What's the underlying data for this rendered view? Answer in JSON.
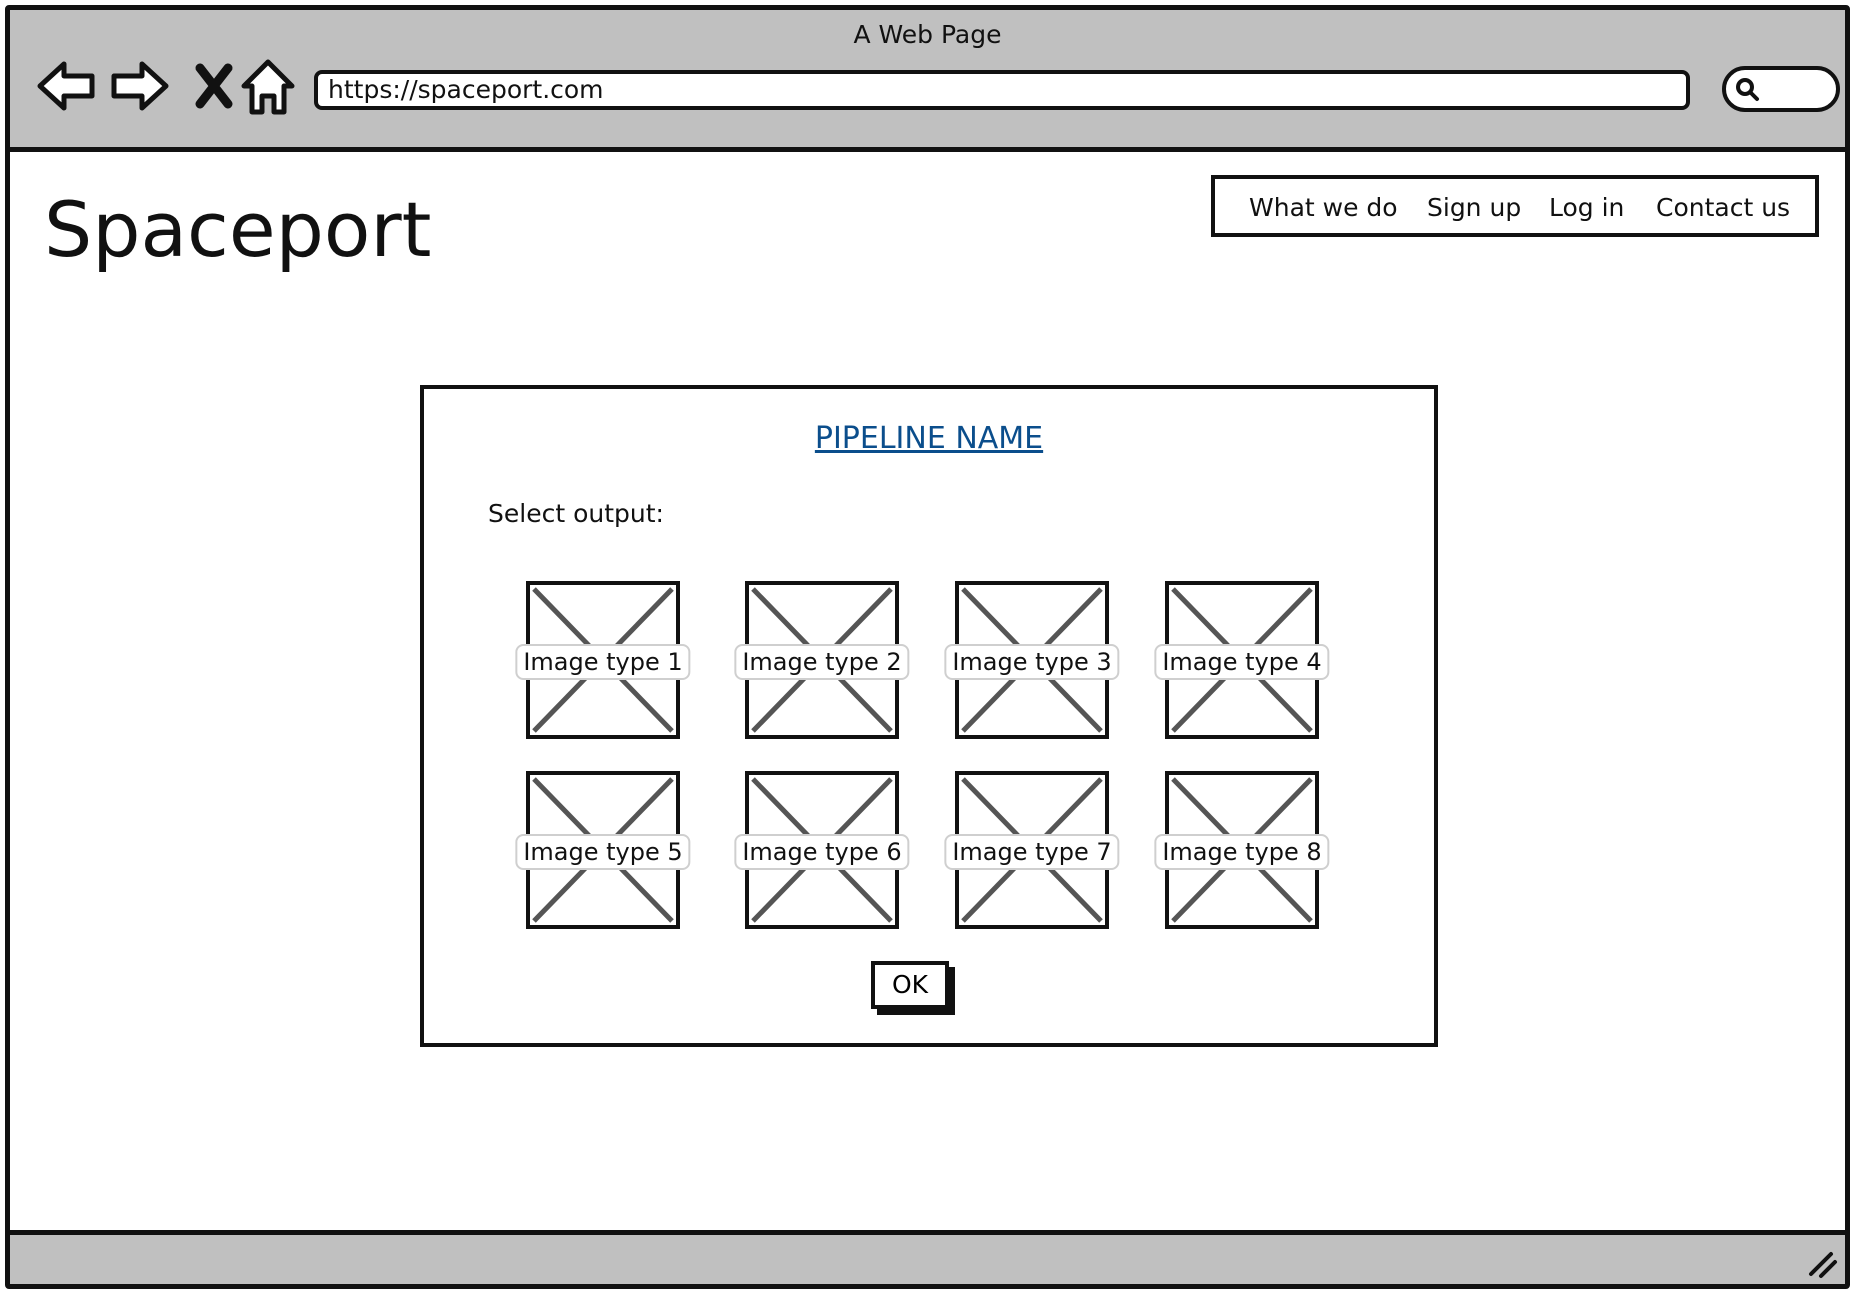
{
  "browser": {
    "window_title": "A Web Page",
    "url": "https://spaceport.com",
    "icons": [
      "back-arrow-icon",
      "forward-arrow-icon",
      "stop-icon",
      "home-icon",
      "search-icon",
      "resize-handle-icon"
    ]
  },
  "site": {
    "title": "Spaceport",
    "nav": [
      "What we do",
      "Sign up",
      "Log in",
      "Contact us"
    ]
  },
  "dialog": {
    "title": "PIPELINE NAME",
    "prompt": "Select output:",
    "options": [
      "Image type 1",
      "Image type 2",
      "Image type 3",
      "Image type 4",
      "Image type 5",
      "Image type 6",
      "Image type 7",
      "Image type 8"
    ],
    "ok_label": "OK"
  },
  "colors": {
    "chrome": "#c0c0c0",
    "link": "#0b4e8c",
    "ink": "#111111"
  }
}
